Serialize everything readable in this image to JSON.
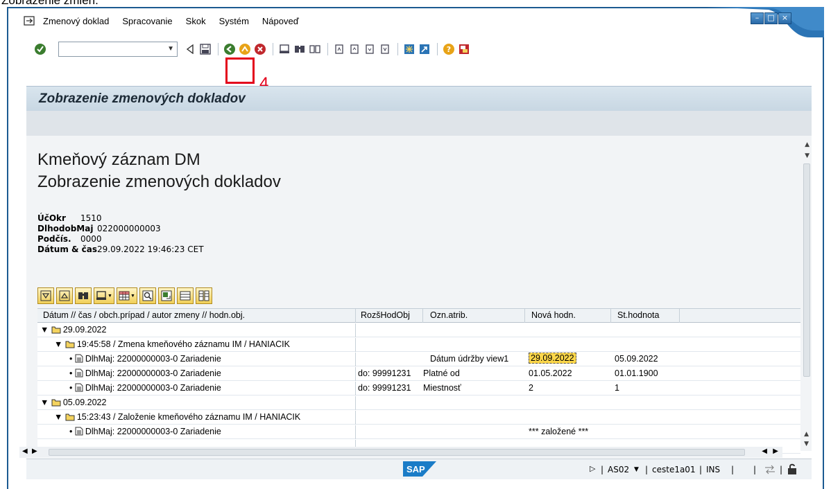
{
  "doc_caption": "Zobrazenie zmien.",
  "menubar": {
    "items": [
      "Zmenový doklad",
      "Spracovanie",
      "Skok",
      "Systém",
      "Nápoveď"
    ]
  },
  "toolbar": {
    "command_value": "",
    "callout_number": "4"
  },
  "title": "Zobrazenie zmenových dokladov",
  "header": {
    "heading_1": "Kmeňový záznam DM",
    "heading_2": "Zobrazenie zmenových dokladov",
    "fields": [
      {
        "label": "ÚčOkr",
        "value": "1510"
      },
      {
        "label": "DlhodobMaj",
        "value": "022000000003"
      },
      {
        "label": "Podčís.",
        "value": "0000"
      },
      {
        "label": "Dátum & čas",
        "value": "29.09.2022 19:46:23 CET"
      }
    ]
  },
  "grid": {
    "columns": {
      "datum": "Dátum  // čas      / obch.prípad      / autor zmeny // hodn.obj.",
      "rozs": "RozšHodObj",
      "ozn": "Ozn.atrib.",
      "nova": "Nová hodn.",
      "stara": "St.hodnota"
    },
    "rows": [
      {
        "tree": "29.09.2022"
      },
      {
        "tree": "19:45:58 / Zmena kmeňového záznamu IM / HANIACIK"
      },
      {
        "tree": "DlhMaj: 22000000003-0 Zariadenie",
        "rozs": "",
        "ozn": "Dátum údržby view1",
        "nova": "29.09.2022",
        "stara": "05.09.2022"
      },
      {
        "tree": "DlhMaj: 22000000003-0 Zariadenie",
        "rozs": "do: 99991231",
        "ozn": "Platné od",
        "nova": "01.05.2022",
        "stara": "01.01.1900"
      },
      {
        "tree": "DlhMaj: 22000000003-0 Zariadenie",
        "rozs": "do: 99991231",
        "ozn": "Miestnosť",
        "nova": "2",
        "stara": "1"
      },
      {
        "tree": "05.09.2022"
      },
      {
        "tree": "15:23:43 / Založenie kmeňového záznamu IM / HANIACIK"
      },
      {
        "tree": "DlhMaj: 22000000003-0 Zariadenie",
        "nova": "*** založené ***"
      }
    ]
  },
  "statusbar": {
    "system": "AS02",
    "server": "ceste1a01",
    "mode": "INS"
  },
  "colors": {
    "accent_blue": "#1b5a91",
    "highlight_yellow": "#fcd74a",
    "callout_red": "#e3001b"
  }
}
